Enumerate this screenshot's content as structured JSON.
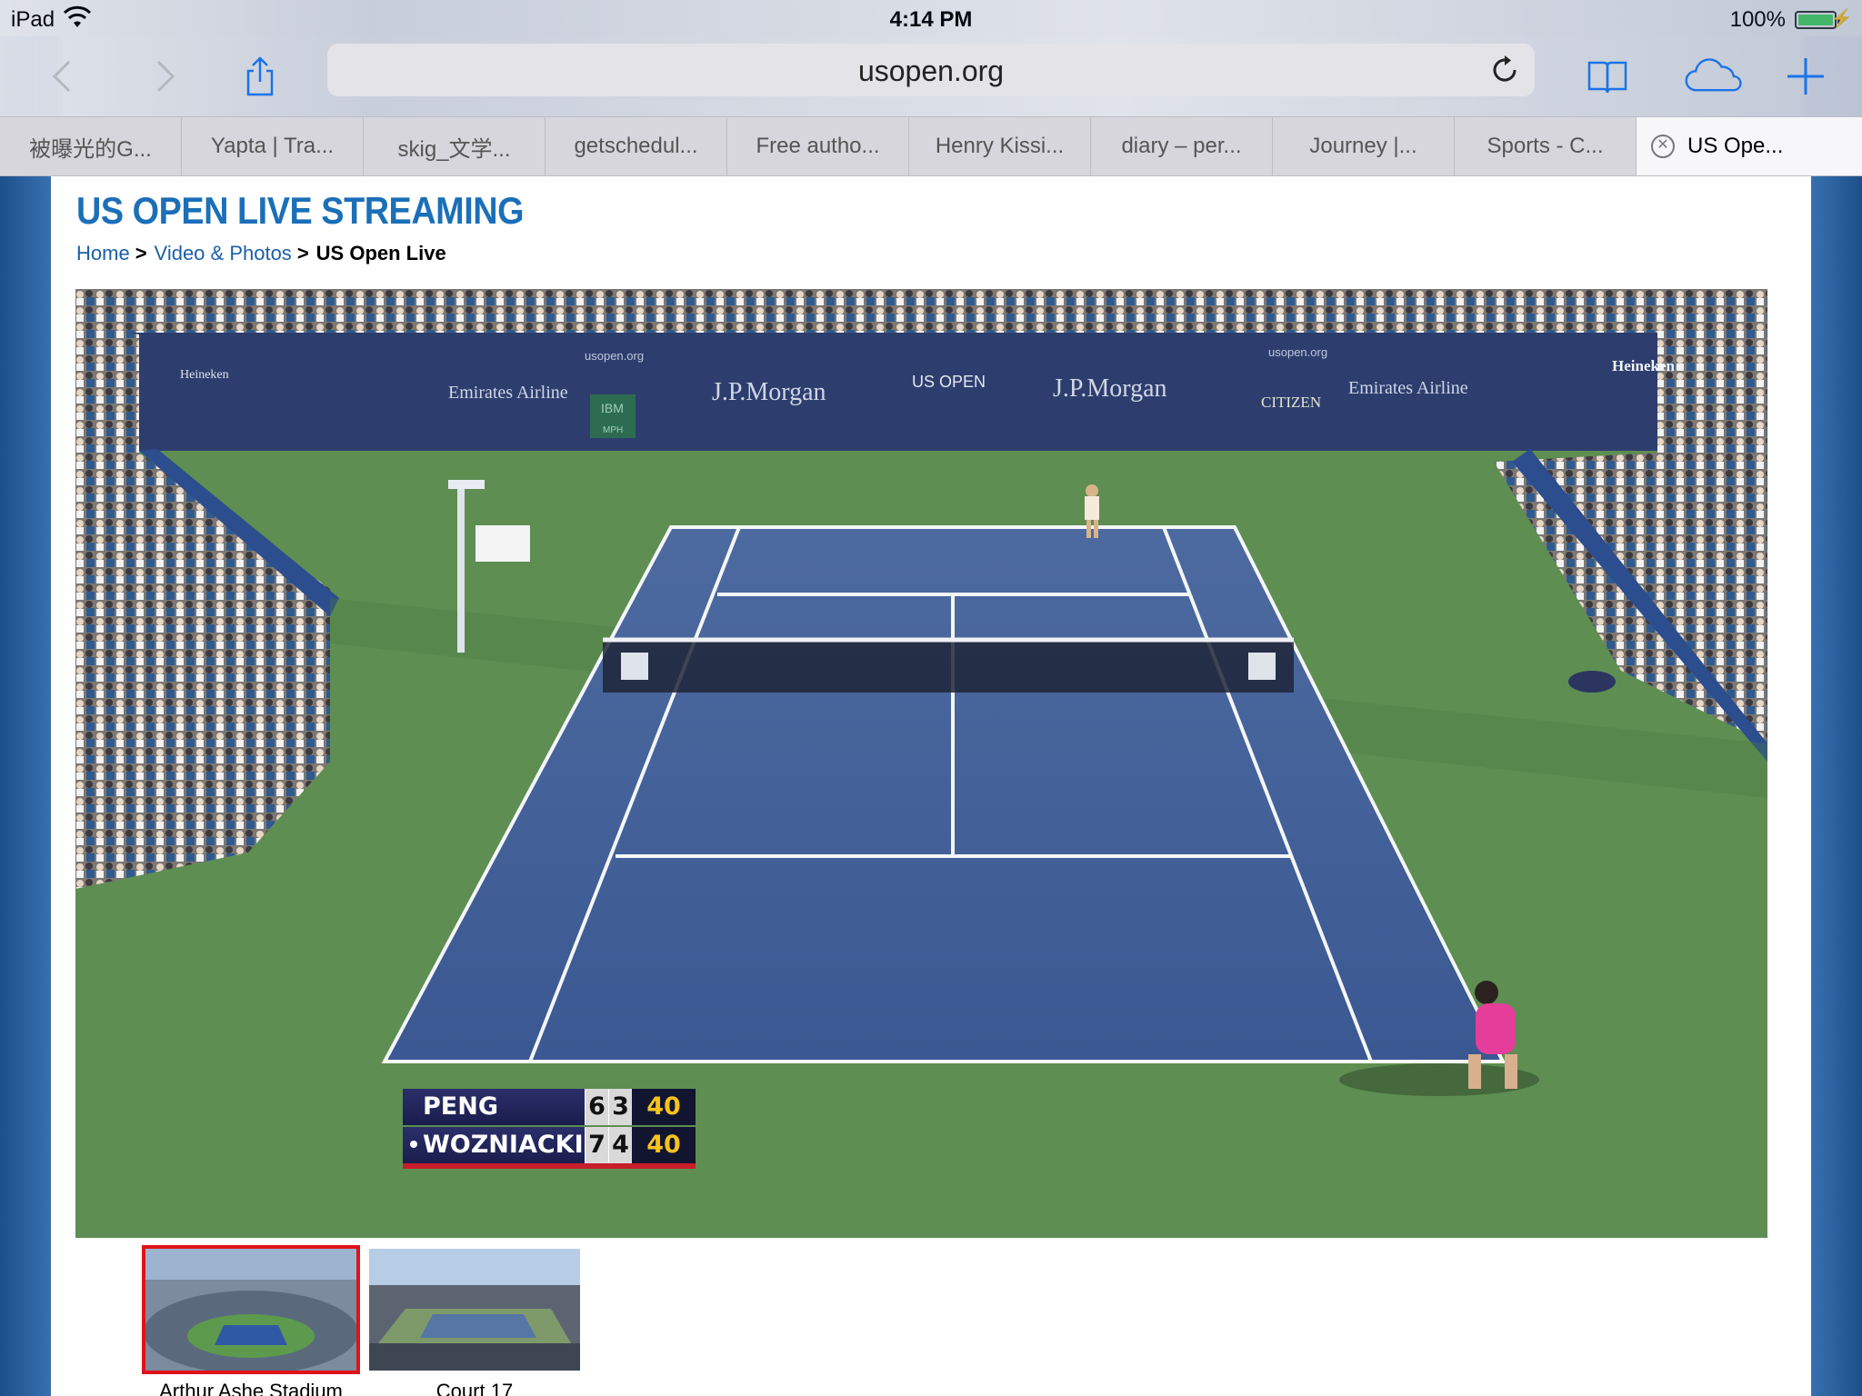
{
  "status_bar": {
    "device": "iPad",
    "time": "4:14 PM",
    "battery_percent": "100%",
    "battery_level": 1.0
  },
  "toolbar": {
    "url": "usopen.org",
    "back_enabled": false,
    "forward_enabled": false,
    "accent_color": "#1a73e8"
  },
  "tabs": [
    {
      "label": "被曝光的G..."
    },
    {
      "label": "Yapta | Tra..."
    },
    {
      "label": "skig_文学..."
    },
    {
      "label": "getschedul..."
    },
    {
      "label": "Free autho..."
    },
    {
      "label": "Henry Kissi..."
    },
    {
      "label": "diary – per..."
    },
    {
      "label": "Journey |..."
    },
    {
      "label": "Sports - C..."
    }
  ],
  "active_tab": {
    "label": "US Ope..."
  },
  "page": {
    "title": "US OPEN LIVE STREAMING",
    "title_color": "#1b6fb8",
    "breadcrumb": {
      "home": "Home",
      "section": "Video & Photos",
      "current": "US Open Live",
      "separator": ">"
    }
  },
  "video": {
    "scoreboard": {
      "players": [
        {
          "name": "PENG",
          "set1": "6",
          "set2": "3",
          "points": "40",
          "serving": false
        },
        {
          "name": "WOZNIACKI",
          "set1": "7",
          "set2": "4",
          "points": "40",
          "serving": true
        }
      ]
    },
    "signage": {
      "emirates_left": "Emirates Airline",
      "emirates_right": "Emirates Airline",
      "jpmorgan_left": "J.P.Morgan",
      "jpmorgan_right": "J.P.Morgan",
      "usopen_logo": "US OPEN",
      "usopen_url_left": "usopen.org",
      "usopen_url_right": "usopen.org",
      "heineken_left": "Heineken",
      "heineken_right": "Heineken",
      "citizen": "CITIZEN",
      "ibm": "IBM",
      "mph": "MPH"
    }
  },
  "courts": [
    {
      "name": "Arthur Ashe Stadium",
      "selected": true
    },
    {
      "name": "Court 17",
      "selected": false
    }
  ]
}
